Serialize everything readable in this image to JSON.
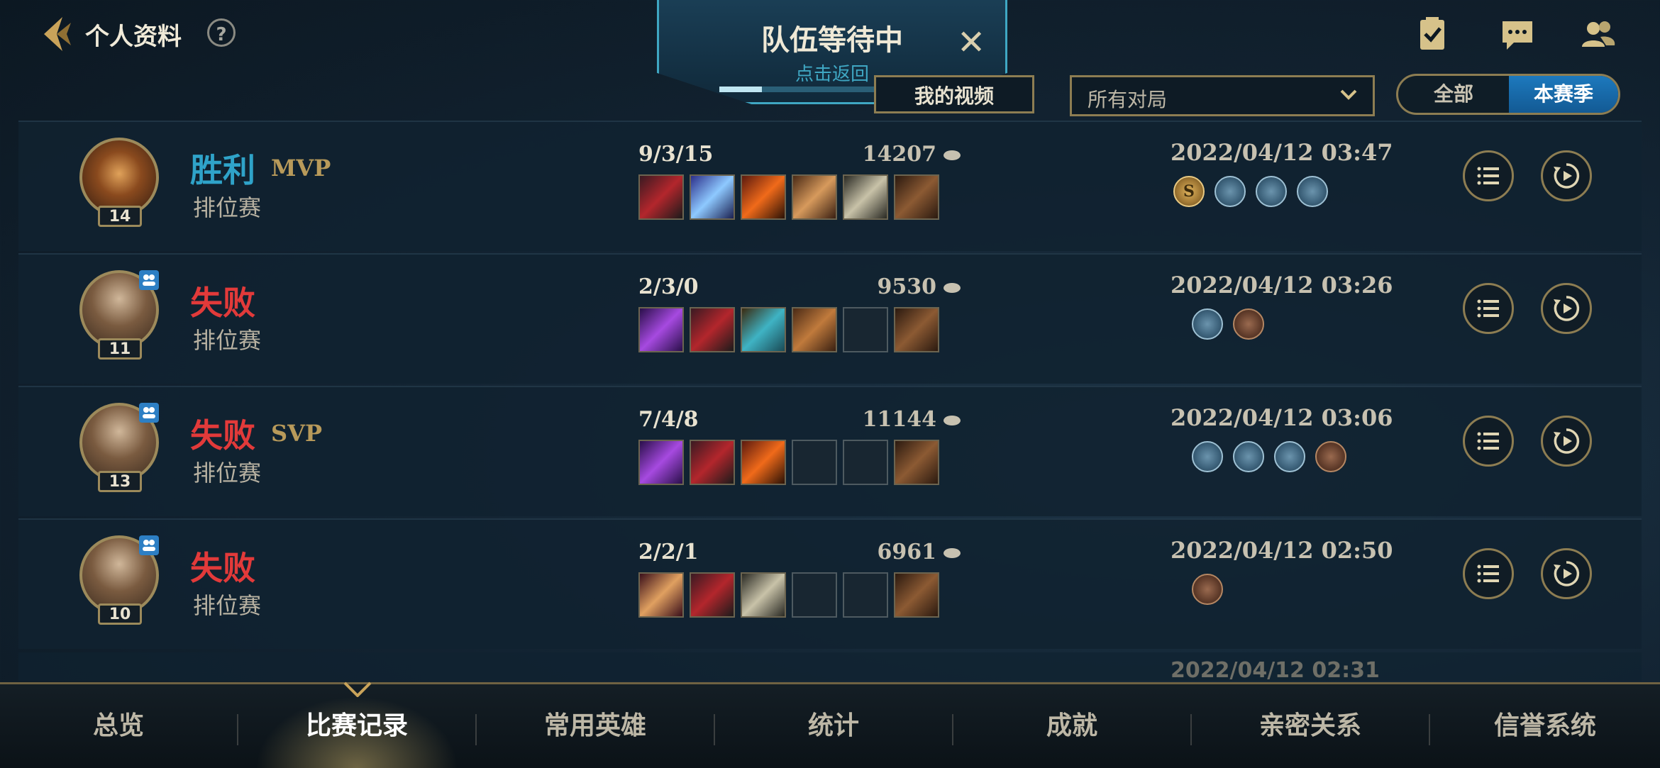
{
  "header": {
    "title": "个人资料",
    "help": "?"
  },
  "queue": {
    "title": "队伍等待中",
    "subtitle": "点击返回",
    "close": "✕"
  },
  "filters": {
    "video_button": "我的视频",
    "match_type": "所有对局",
    "segment_all": "全部",
    "segment_season": "本赛季"
  },
  "matches": [
    {
      "result": "胜利",
      "honor": "MVP",
      "mode": "排位赛",
      "level": "14",
      "kda": "9/3/15",
      "gold": "14207",
      "date": "2022/04/12 03:47"
    },
    {
      "result": "失败",
      "honor": "",
      "mode": "排位赛",
      "level": "11",
      "kda": "2/3/0",
      "gold": "9530",
      "date": "2022/04/12 03:26"
    },
    {
      "result": "失败",
      "honor": "SVP",
      "mode": "排位赛",
      "level": "13",
      "kda": "7/4/8",
      "gold": "11144",
      "date": "2022/04/12 03:06"
    },
    {
      "result": "失败",
      "honor": "",
      "mode": "排位赛",
      "level": "10",
      "kda": "2/2/1",
      "gold": "6961",
      "date": "2022/04/12 02:50"
    }
  ],
  "peek_date": "2022/04/12 02:31",
  "badges": {
    "mvp_badge": "S"
  },
  "nav": {
    "items": [
      "总览",
      "比赛记录",
      "常用英雄",
      "统计",
      "成就",
      "亲密关系",
      "信誉系统"
    ],
    "active": "比赛记录"
  },
  "colors": {
    "win": "#2fa3c9",
    "lose": "#e23a3a",
    "gold_accent": "#8d7d52",
    "queue_accent": "#3fa7c3"
  }
}
